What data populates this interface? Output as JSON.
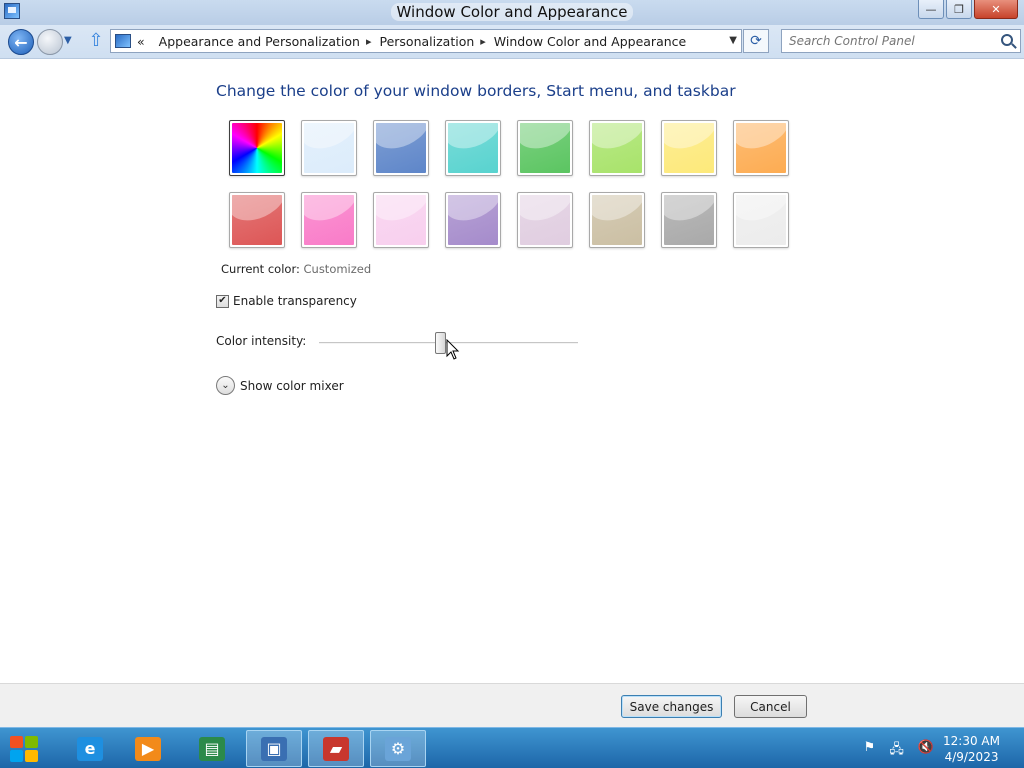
{
  "window": {
    "title": "Window Color and Appearance",
    "controls": {
      "minimize": "—",
      "restore": "❐",
      "close": "✕"
    }
  },
  "address_bar": {
    "back_glyph": "←",
    "overflow_glyph": "«",
    "crumbs": [
      "Appearance and Personalization",
      "Personalization",
      "Window Color and Appearance"
    ],
    "crumb_separator": "▸",
    "refresh_glyph": "⟳",
    "search_placeholder": "Search Control Panel"
  },
  "main": {
    "heading": "Change the color of your window borders, Start menu, and taskbar",
    "swatches": [
      {
        "name": "custom-rainbow",
        "color": "conic"
      },
      {
        "name": "sky",
        "color": "#dcecfb"
      },
      {
        "name": "twilight",
        "color": "#5e86c9"
      },
      {
        "name": "sea-foam",
        "color": "#58d3cf"
      },
      {
        "name": "leaf",
        "color": "#5bc561"
      },
      {
        "name": "lime",
        "color": "#a8e36a"
      },
      {
        "name": "banana",
        "color": "#fde97a"
      },
      {
        "name": "pumpkin",
        "color": "#fdac52"
      },
      {
        "name": "ruby",
        "color": "#dd5656"
      },
      {
        "name": "fuchsia",
        "color": "#f97bc8"
      },
      {
        "name": "blush",
        "color": "#f8cfee"
      },
      {
        "name": "violet",
        "color": "#a58bcb"
      },
      {
        "name": "lavender",
        "color": "#e0cde0"
      },
      {
        "name": "taupe",
        "color": "#cbbfa3"
      },
      {
        "name": "chocolate",
        "color": "#a9a9a9"
      },
      {
        "name": "frost",
        "color": "#ececec"
      }
    ],
    "current_color_label": "Current color:",
    "current_color_value": "Customized",
    "enable_transparency": {
      "label": "Enable transparency",
      "checked": true,
      "check_glyph": "✔"
    },
    "color_intensity": {
      "label": "Color intensity:",
      "value_fraction": 0.47
    },
    "show_color_mixer": {
      "label": "Show color mixer",
      "glyph": "⌄"
    }
  },
  "footer": {
    "save_label": "Save changes",
    "cancel_label": "Cancel"
  },
  "taskbar": {
    "items": [
      {
        "name": "internet-explorer",
        "glyph": "e",
        "color": "#1e8fe0"
      },
      {
        "name": "media-player",
        "glyph": "▶",
        "color": "#f28a1a"
      },
      {
        "name": "document-viewer",
        "glyph": "▤",
        "color": "#2b8a4a"
      },
      {
        "name": "computer",
        "glyph": "▣",
        "color": "#3a6fb2"
      },
      {
        "name": "toolbox",
        "glyph": "▰",
        "color": "#c8372d"
      },
      {
        "name": "control-panel",
        "glyph": "⚙",
        "color": "#6aa4d8"
      }
    ],
    "tray_icons": [
      "flag-icon",
      "network-icon",
      "volume-muted-icon"
    ],
    "time": "12:30 AM",
    "date": "4/9/2023"
  }
}
